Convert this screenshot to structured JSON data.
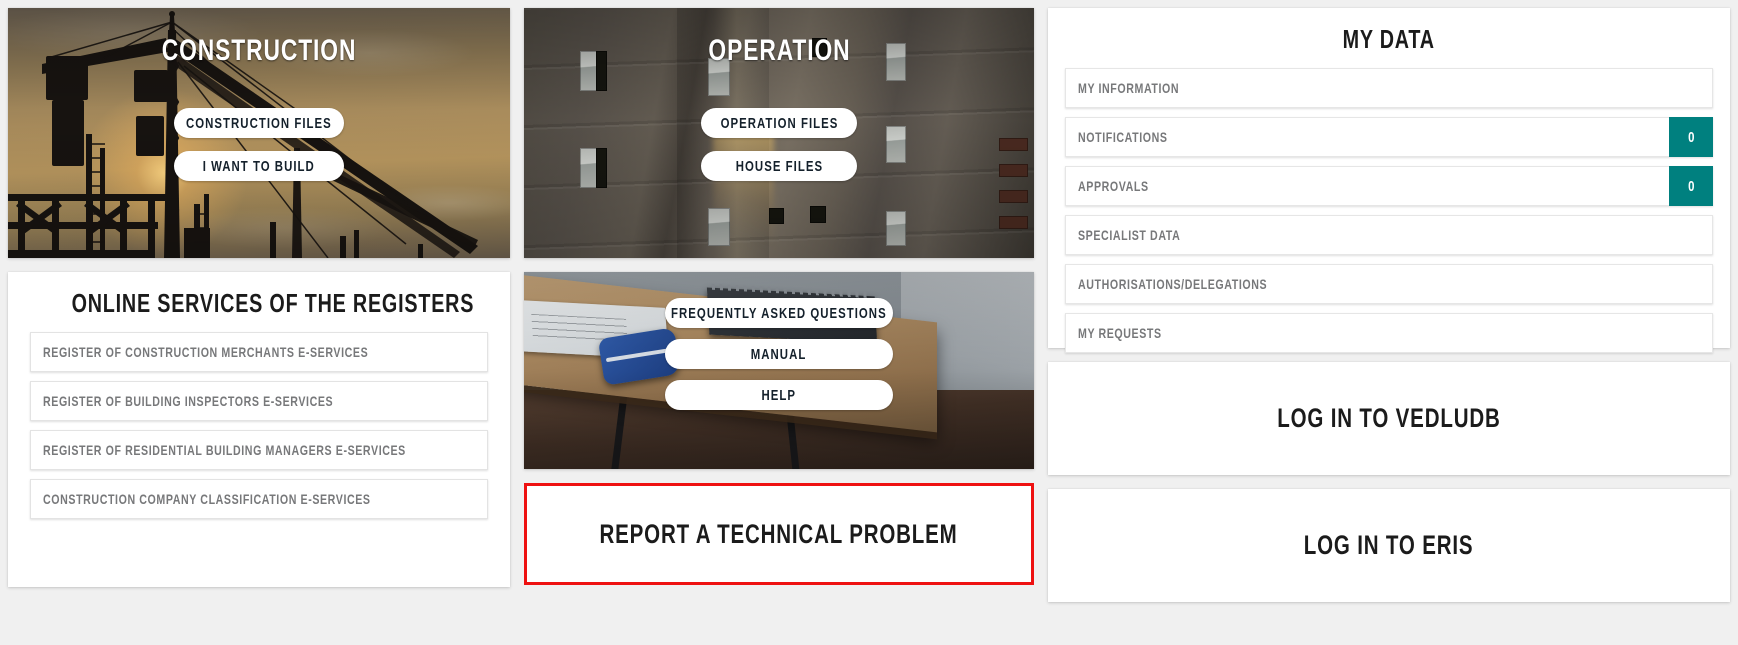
{
  "construction": {
    "title": "CONSTRUCTION",
    "buttons": [
      {
        "label": "CONSTRUCTION FILES"
      },
      {
        "label": "I WANT TO BUILD"
      }
    ]
  },
  "operation": {
    "title": "OPERATION",
    "buttons": [
      {
        "label": "OPERATION FILES"
      },
      {
        "label": "HOUSE FILES"
      }
    ]
  },
  "registers": {
    "title": "ONLINE SERVICES OF THE REGISTERS",
    "items": [
      {
        "label": "REGISTER OF CONSTRUCTION MERCHANTS E-SERVICES"
      },
      {
        "label": "REGISTER OF BUILDING INSPECTORS E-SERVICES"
      },
      {
        "label": "REGISTER OF RESIDENTIAL BUILDING MANAGERS E-SERVICES"
      },
      {
        "label": "CONSTRUCTION COMPANY CLASSIFICATION E-SERVICES"
      }
    ]
  },
  "help": {
    "buttons": [
      {
        "label": "FREQUENTLY ASKED QUESTIONS"
      },
      {
        "label": "MANUAL"
      },
      {
        "label": "HELP"
      }
    ]
  },
  "report": {
    "label": "REPORT A TECHNICAL PROBLEM",
    "border_color": "#ee1111"
  },
  "my_data": {
    "title": "MY DATA",
    "badge_color": "#00807f",
    "items": [
      {
        "label": "MY INFORMATION",
        "count": null
      },
      {
        "label": "NOTIFICATIONS",
        "count": "0"
      },
      {
        "label": "APPROVALS",
        "count": "0"
      },
      {
        "label": "SPECIALIST DATA",
        "count": null
      },
      {
        "label": "AUTHORISATIONS/DELEGATIONS",
        "count": null
      },
      {
        "label": "MY REQUESTS",
        "count": null
      }
    ]
  },
  "logins": [
    {
      "label": "LOG IN TO VEDLUDB"
    },
    {
      "label": "LOG IN TO ERIS"
    }
  ]
}
